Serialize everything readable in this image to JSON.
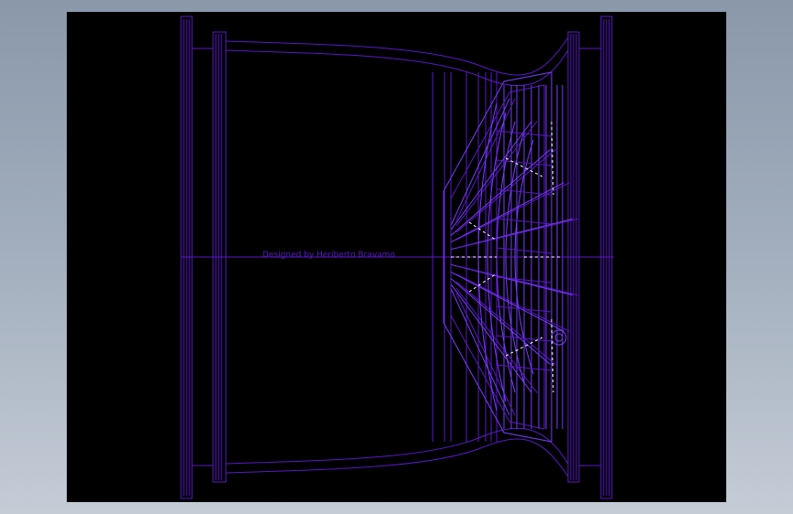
{
  "viewport": {
    "background": "#000000",
    "line_color": "#5a18c8",
    "line_color_light": "#7a3cff",
    "highlight_color": "#ffffff"
  },
  "drawing": {
    "subject": "wheel-rim-wireframe",
    "watermark_text": "Designed by Heriberto Bravamo"
  }
}
